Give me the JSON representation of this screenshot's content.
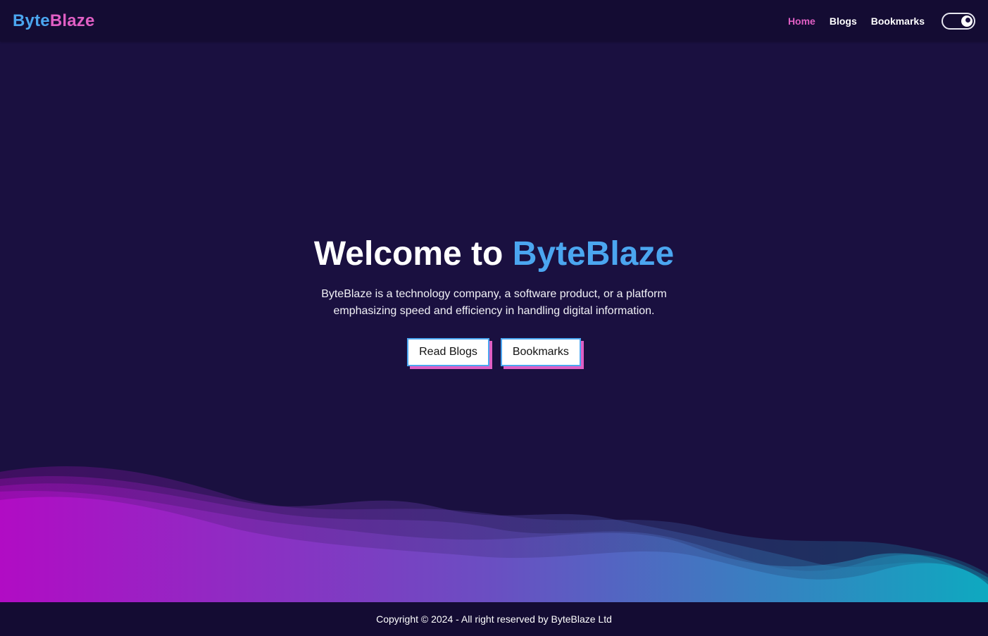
{
  "nav": {
    "logo_part1": "Byte",
    "logo_part2": "Blaze",
    "links": [
      {
        "label": "Home",
        "active": true
      },
      {
        "label": "Blogs",
        "active": false
      },
      {
        "label": "Bookmarks",
        "active": false
      }
    ],
    "theme_toggle_icon": "dark-mode-toggle-icon"
  },
  "hero": {
    "title_prefix": "Welcome to ",
    "title_brand": "ByteBlaze",
    "description": "ByteBlaze is a technology company, a software product, or a platform emphasizing speed and efficiency in handling digital information.",
    "buttons": [
      {
        "label": "Read Blogs"
      },
      {
        "label": "Bookmarks"
      }
    ]
  },
  "footer": {
    "text": "Copyright © 2024 - All right reserved by ByteBlaze Ltd"
  },
  "colors": {
    "background": "#1a1040",
    "nav_background": "#140c33",
    "brand_blue": "#4ba6f0",
    "brand_pink": "#e05fc4",
    "wave_start": "#b10cc4",
    "wave_end": "#0ea9c0"
  }
}
